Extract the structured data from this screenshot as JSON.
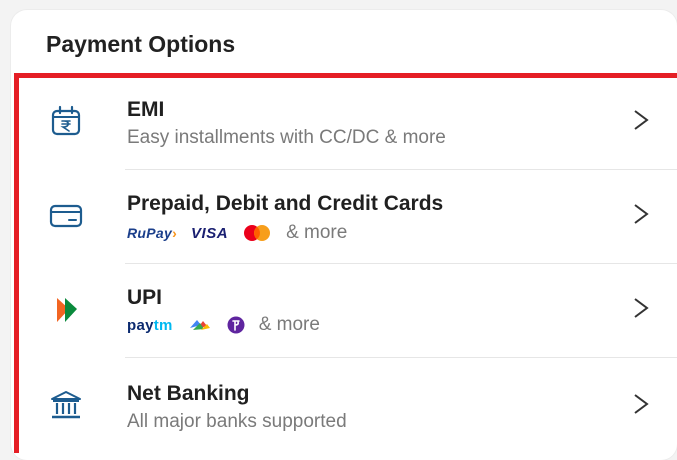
{
  "header": {
    "title": "Payment Options"
  },
  "options": [
    {
      "name": "EMI",
      "subtitle": "Easy installments with CC/DC & more",
      "icon": "calendar-rupee-icon"
    },
    {
      "name": "Prepaid, Debit and Credit Cards",
      "logos": [
        "RuPay",
        "VISA",
        "mastercard"
      ],
      "more": "& more",
      "icon": "credit-card-icon"
    },
    {
      "name": "UPI",
      "logos": [
        "Paytm",
        "google-pay",
        "phonepe"
      ],
      "more": "& more",
      "icon": "upi-icon"
    },
    {
      "name": "Net Banking",
      "subtitle": "All major banks supported",
      "icon": "bank-icon"
    }
  ],
  "logo_text": {
    "rupay": "RuPay",
    "visa": "VISA",
    "paytm_a": "pay",
    "paytm_b": "tm"
  },
  "colors": {
    "accent_border": "#e51e25",
    "icon_blue": "#1d5c8f"
  }
}
